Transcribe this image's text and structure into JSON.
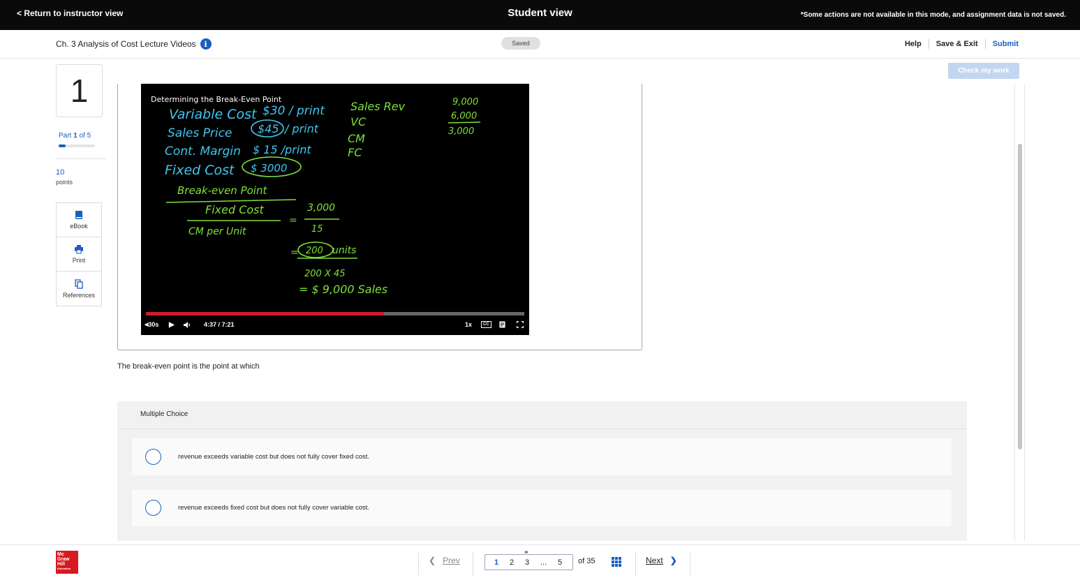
{
  "topbar": {
    "return_label": "< Return to instructor view",
    "center_title": "Student view",
    "notice": "*Some actions are not available in this mode, and assignment data is not saved."
  },
  "header": {
    "assignment_title": "Ch. 3 Analysis of Cost Lecture Videos",
    "saved_label": "Saved",
    "help_label": "Help",
    "save_exit_label": "Save & Exit",
    "submit_label": "Submit",
    "check_work_label": "Check my work"
  },
  "left": {
    "question_number": "1",
    "part_prefix": "Part",
    "part_current": "1",
    "part_suffix": "of 5",
    "part_progress": 0.2,
    "points_value": "10",
    "points_label": "points",
    "tools": [
      {
        "label": "eBook",
        "icon": "book-icon"
      },
      {
        "label": "Print",
        "icon": "printer-icon"
      },
      {
        "label": "References",
        "icon": "copy-icon"
      }
    ]
  },
  "video": {
    "slide_title": "Determining the Break-Even Point",
    "handwriting": {
      "l1": "Variable Cost",
      "l1v": "$30 / print",
      "l2": "Sales Price",
      "l2v": "$45",
      "l2u": "/ print",
      "l3": "Cont. Margin",
      "l3v": "$ 15 /print",
      "l4": "Fixed Cost",
      "l4v": "$ 3000",
      "bep": "Break-even Point",
      "fixed_cost": "Fixed Cost",
      "cm_unit": "CM per Unit",
      "eq": "=",
      "num": "3,000",
      "den": "15",
      "eq2": "=",
      "units_circled": "200",
      "units": "units",
      "calc": "200 X 45",
      "sales": "= $ 9,000 Sales",
      "r1": "Sales Rev",
      "r2": "VC",
      "r3": "CM",
      "r4": "FC",
      "n1": "9,000",
      "n2": "6,000",
      "n3": "3,000"
    },
    "progress_fraction": 0.63,
    "rewind_label": "30s",
    "time_display": "4:37 / 7:21",
    "speed_label": "1x",
    "cc_label": "CC"
  },
  "question": {
    "prompt": "The break-even point is the point at which",
    "type_label": "Multiple Choice",
    "choices": [
      "revenue exceeds variable cost but does not fully cover fixed cost.",
      "revenue exceeds fixed cost but does not fully cover variable cost."
    ]
  },
  "footer": {
    "logo_lines": [
      "Mc",
      "Graw",
      "Hill",
      "Education"
    ],
    "prev_label": "Prev",
    "pages": [
      "1",
      "2",
      "3",
      "...",
      "5"
    ],
    "of_label": "of 35",
    "next_label": "Next",
    "accent_color": "#1a5ebf"
  }
}
